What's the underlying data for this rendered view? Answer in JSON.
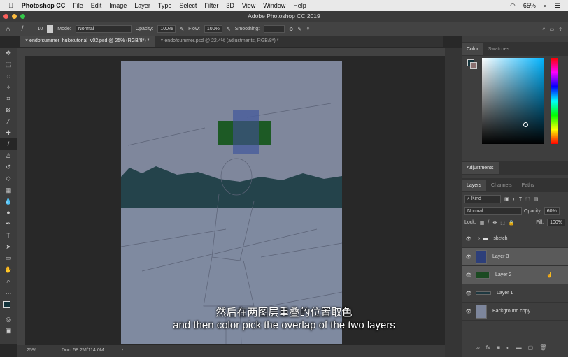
{
  "menubar": {
    "app": "Photoshop CC",
    "items": [
      "File",
      "Edit",
      "Image",
      "Layer",
      "Type",
      "Select",
      "Filter",
      "3D",
      "View",
      "Window",
      "Help"
    ],
    "battery": "65%"
  },
  "window": {
    "title": "Adobe Photoshop CC 2019"
  },
  "options": {
    "brush_size": "10",
    "mode_label": "Mode:",
    "mode": "Normal",
    "opacity_label": "Opacity:",
    "opacity": "100%",
    "flow_label": "Flow:",
    "flow": "100%",
    "smoothing_label": "Smoothing:"
  },
  "tabs": [
    {
      "label": "endofsummer_huketutorial_v02.psd @ 25% (RGB/8*) *"
    },
    {
      "label": "endofsummer.psd @ 22.4% (adjustments, RGB/8*) *"
    }
  ],
  "status": {
    "zoom": "25%",
    "doc": "Doc: 58.2M/114.0M"
  },
  "color_panel": {
    "tabs": [
      "Color",
      "Swatches"
    ],
    "foreground": "#12323a",
    "background": "#8a7070"
  },
  "adjustments": {
    "title": "Adjustments"
  },
  "layers_panel": {
    "tabs": [
      "Layers",
      "Channels",
      "Paths"
    ],
    "filter": "Kind",
    "blend": "Normal",
    "opacity_label": "Opacity:",
    "opacity": "60%",
    "lock_label": "Lock:",
    "fill_label": "Fill:",
    "fill": "100%",
    "layers": [
      {
        "name": "sketch",
        "type": "group"
      },
      {
        "name": "Layer 3",
        "color": "#2d3f7a"
      },
      {
        "name": "Layer 2",
        "color": "#1b4a22"
      },
      {
        "name": "Layer 1",
        "color": "#1e3840"
      },
      {
        "name": "Background copy",
        "color": "#7d869c"
      }
    ]
  },
  "subtitles": {
    "chinese": "然后在两图层重叠的位置取色",
    "english": "and then color pick the overlap of the two layers"
  }
}
